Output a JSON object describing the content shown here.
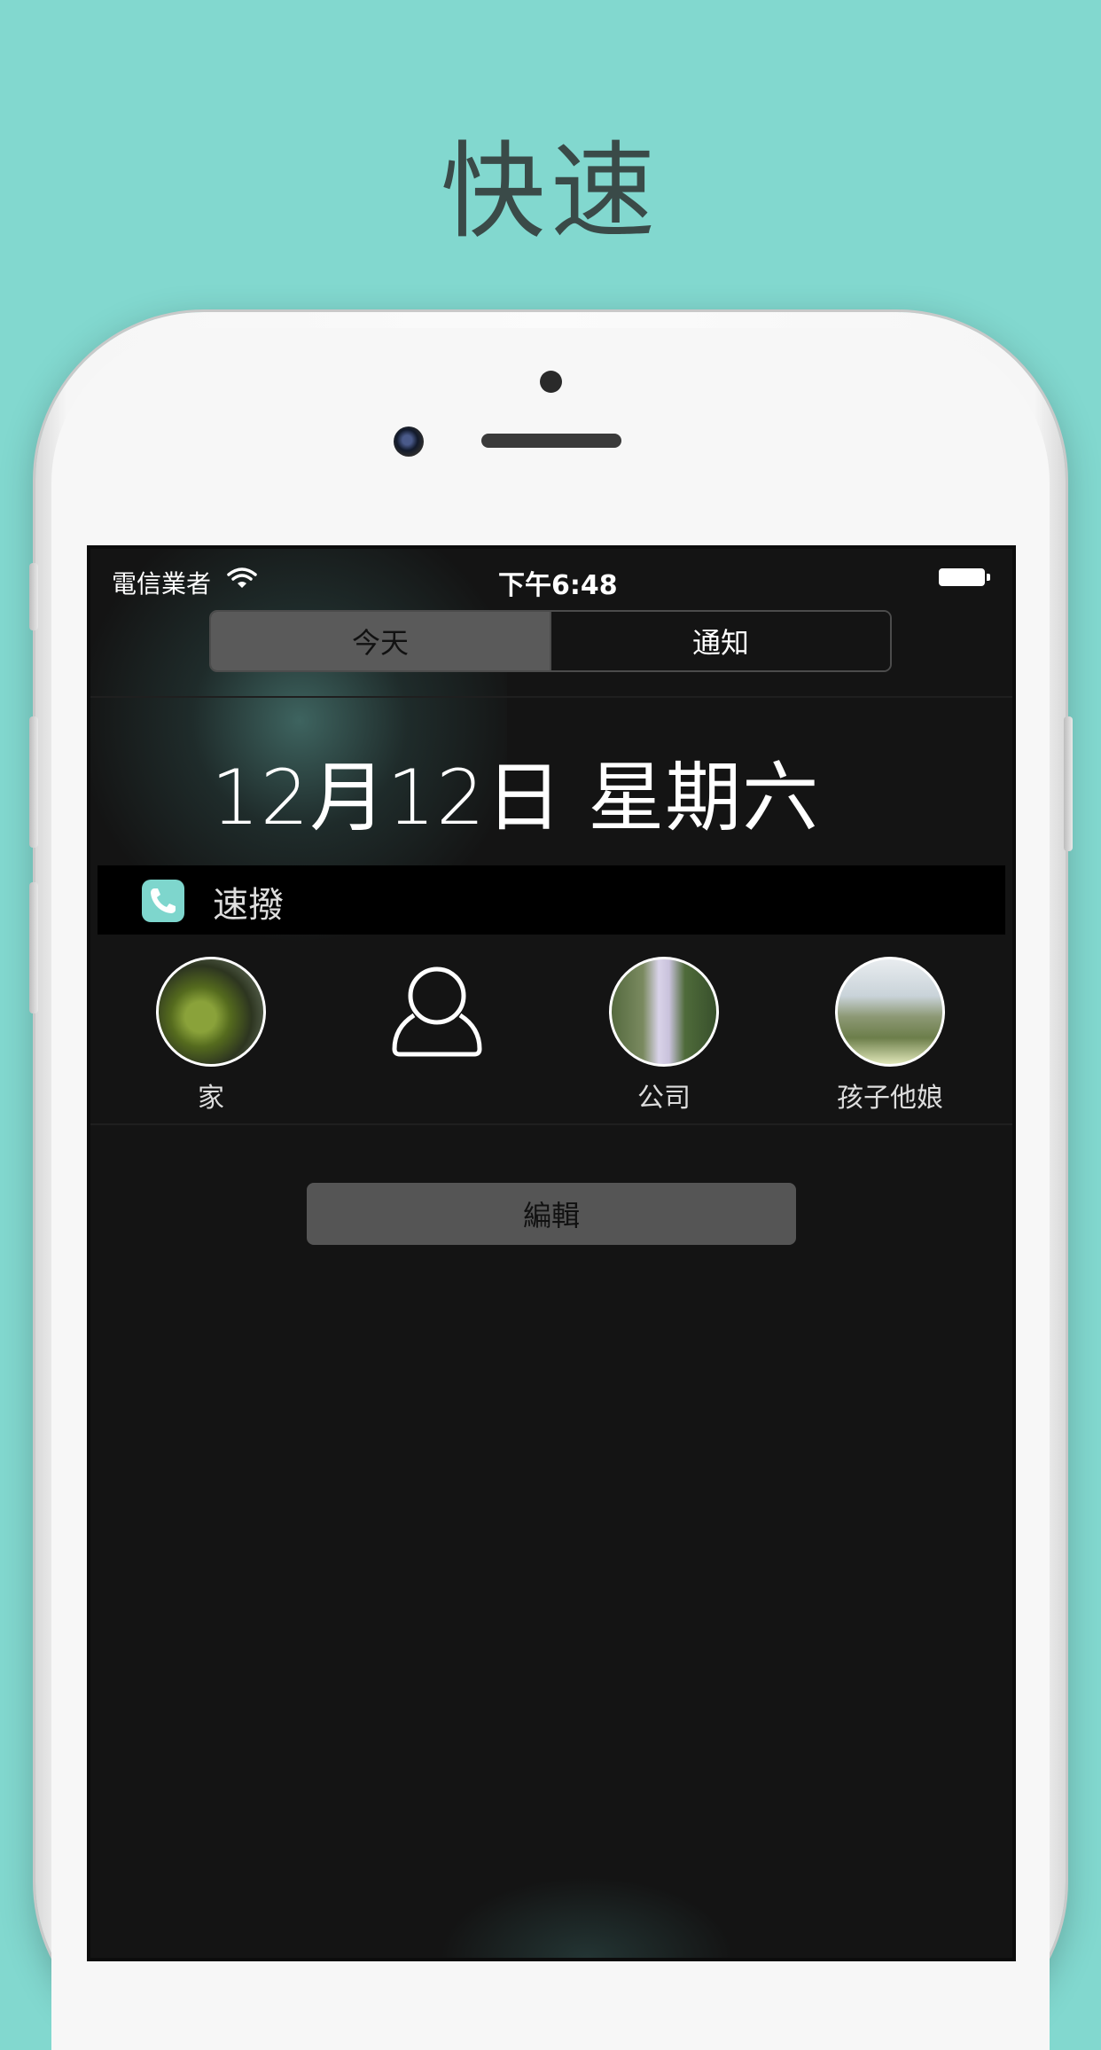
{
  "headline": "快速",
  "status_bar": {
    "carrier": "電信業者",
    "time": "下午6:48",
    "wifi_icon": "wifi-icon",
    "battery_icon": "battery-icon"
  },
  "segments": [
    {
      "label": "今天",
      "selected": true
    },
    {
      "label": "通知",
      "selected": false
    }
  ],
  "date": "12月12日 星期六",
  "widget": {
    "title": "速撥",
    "icon": "phone-icon",
    "contacts": [
      {
        "name": "家",
        "avatar": "photo"
      },
      {
        "name": "",
        "avatar": "placeholder-person-icon"
      },
      {
        "name": "公司",
        "avatar": "photo"
      },
      {
        "name": "孩子他娘",
        "avatar": "photo"
      }
    ],
    "edit_label": "編輯"
  },
  "colors": {
    "background": "#82d8cf",
    "accent": "#7ed6cd",
    "screen": "#141414"
  }
}
